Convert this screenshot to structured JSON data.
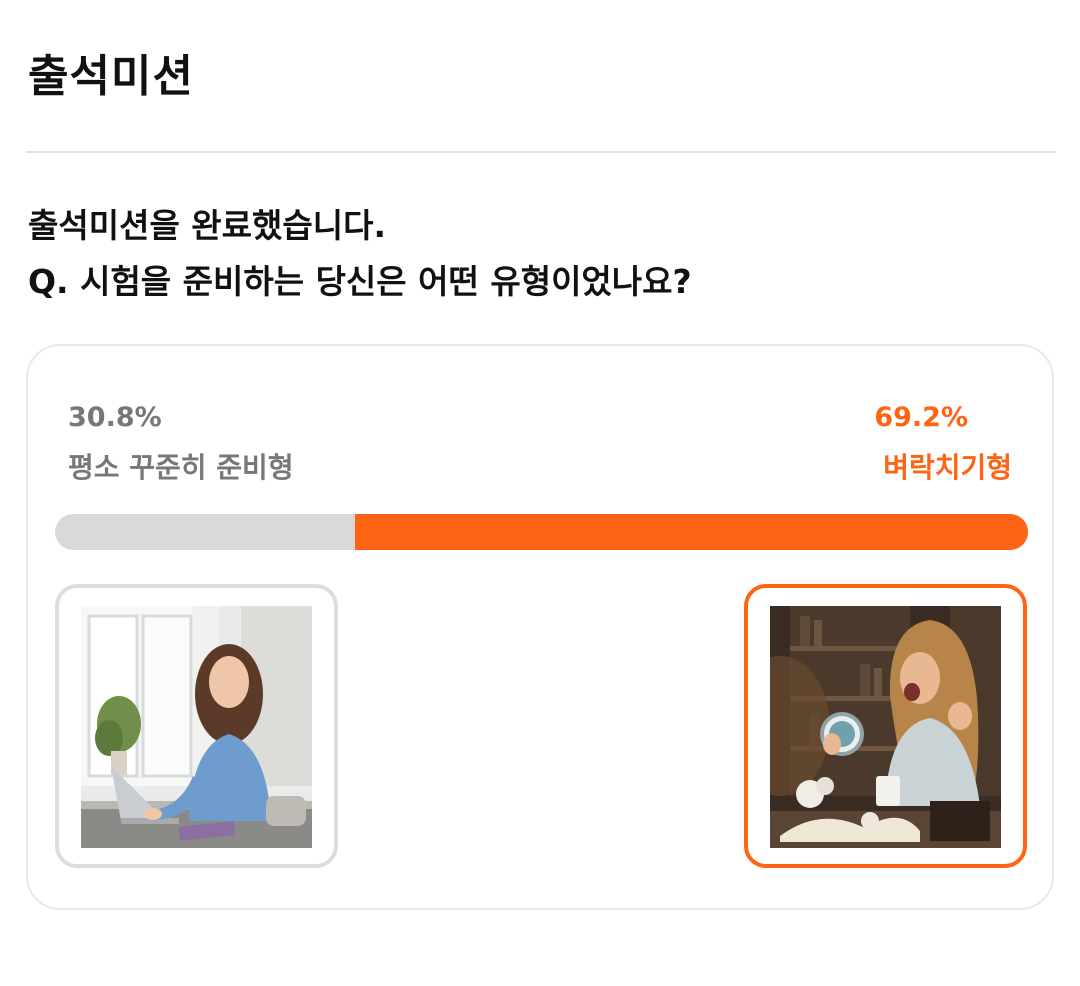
{
  "header": {
    "title": "출석미션"
  },
  "question": {
    "line1": "출석미션을 완료했습니다.",
    "line2": "Q. 시험을 준비하는 당신은 어떤 유형이었나요?"
  },
  "poll": {
    "left_option": {
      "percent_text": "30.8%",
      "label": "평소 꾸준히 준비형",
      "value": 30.8,
      "image": "steady-studier-photo"
    },
    "right_option": {
      "percent_text": "69.2%",
      "label": "벼락치기형",
      "value": 69.2,
      "image": "cramming-studier-photo",
      "selected": true
    },
    "colors": {
      "accent": "#ff6414",
      "neutral_bar": "#d9d9d9",
      "neutral_text": "#777777"
    }
  }
}
